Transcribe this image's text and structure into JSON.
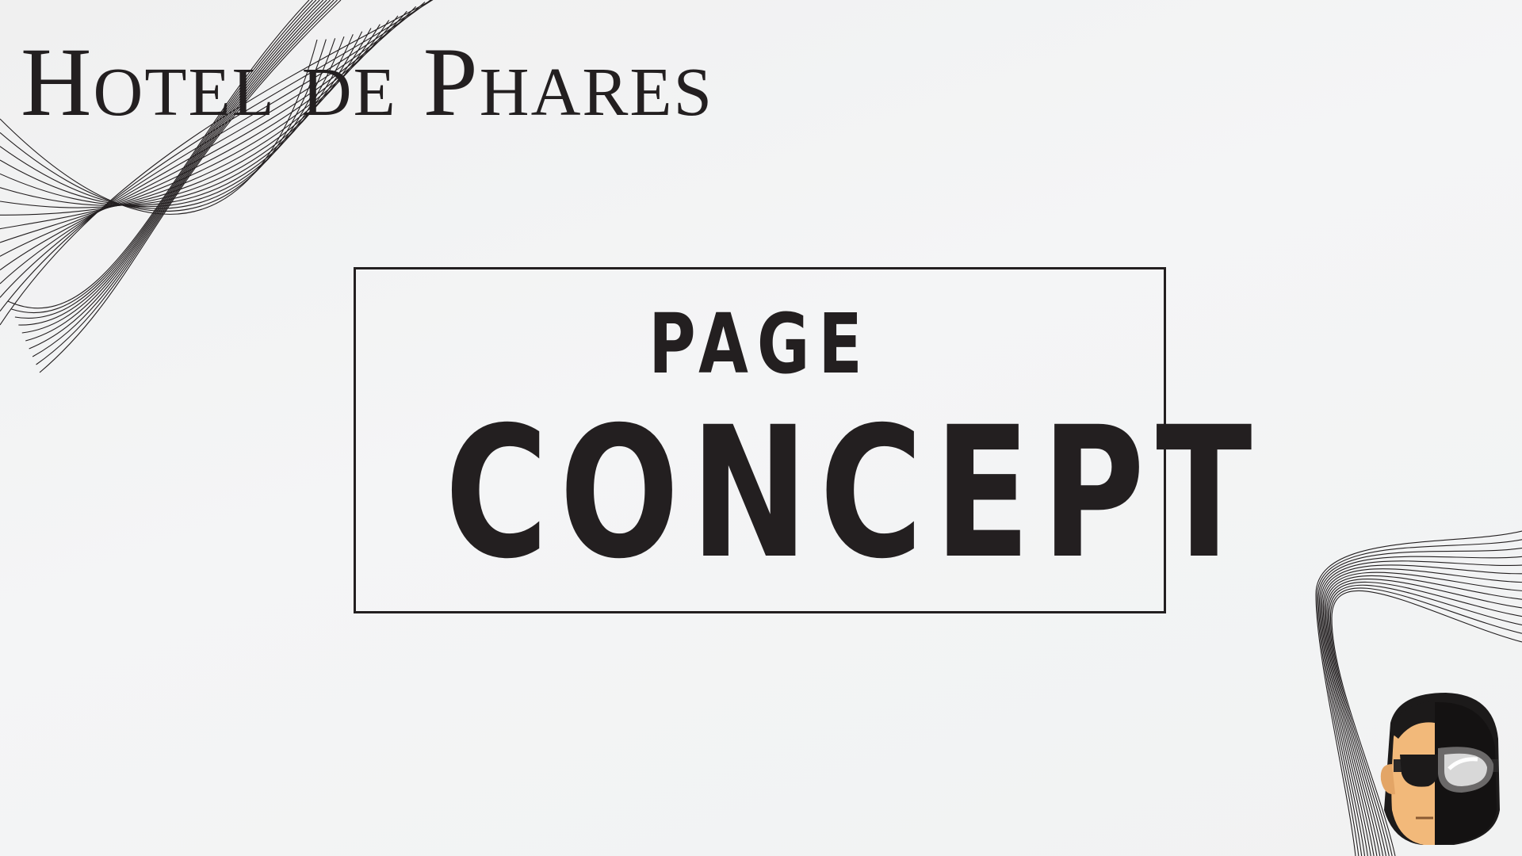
{
  "brand": {
    "name": "Hotel de Phares"
  },
  "title": {
    "line1": "PAGE",
    "line2": "CONCEPT"
  },
  "colors": {
    "ink": "#231f20",
    "background": "#f3f4f5",
    "skin": "#f2b97a"
  },
  "decorations": {
    "top_left": "wave-lines",
    "bottom_right": "wave-lines",
    "avatar": "half-face-with-goggles-avatar"
  }
}
